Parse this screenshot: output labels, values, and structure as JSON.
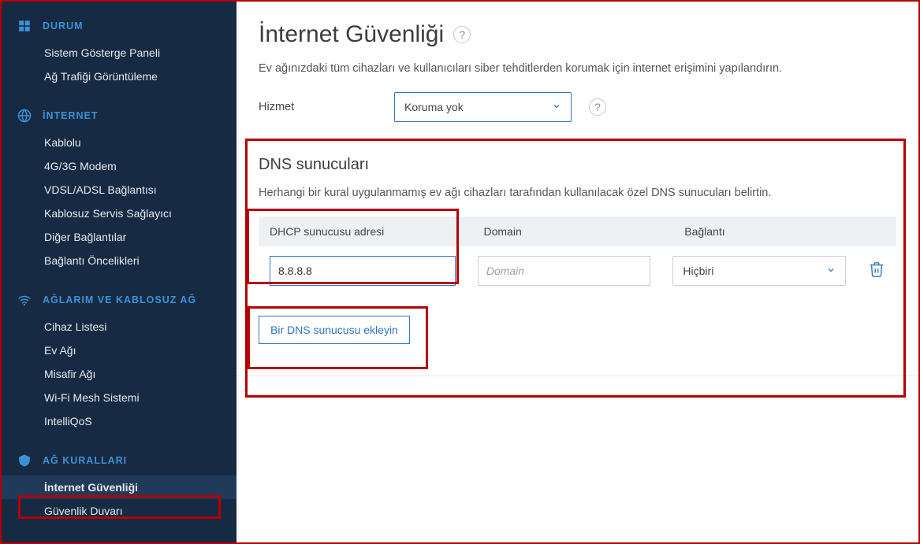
{
  "sidebar": {
    "sections": [
      {
        "title": "DURUM",
        "icon": "dashboard-icon",
        "items": [
          "Sistem Gösterge Paneli",
          "Ağ Trafiği Görüntüleme"
        ]
      },
      {
        "title": "İNTERNET",
        "icon": "globe-icon",
        "items": [
          "Kablolu",
          "4G/3G Modem",
          "VDSL/ADSL Bağlantısı",
          "Kablosuz Servis Sağlayıcı",
          "Diğer Bağlantılar",
          "Bağlantı Öncelikleri"
        ]
      },
      {
        "title": "AĞLARIM VE KABLOSUZ AĞ",
        "icon": "wifi-icon",
        "items": [
          "Cihaz Listesi",
          "Ev Ağı",
          "Misafir Ağı",
          "Wi-Fi Mesh Sistemi",
          "IntelliQoS"
        ]
      },
      {
        "title": "AĞ KURALLARI",
        "icon": "shield-icon",
        "items": [
          "İnternet Güvenliği",
          "Güvenlik Duvarı"
        ],
        "activeIndex": 0
      }
    ]
  },
  "main": {
    "title": "İnternet Güvenliği",
    "subtitle": "Ev ağınızdaki tüm cihazları ve kullanıcıları siber tehditlerden korumak için internet erişimini yapılandırın.",
    "serviceLabel": "Hizmet",
    "serviceValue": "Koruma yok",
    "dns": {
      "title": "DNS sunucuları",
      "hint": "Herhangi bir kural uygulanmamış ev ağı cihazları tarafından kullanılacak özel DNS sunucuları belirtin.",
      "headers": {
        "dhcp": "DHCP sunucusu adresi",
        "domain": "Domain",
        "conn": "Bağlantı"
      },
      "row": {
        "dhcpValue": "8.8.8.8",
        "domainPlaceholder": "Domain",
        "connValue": "Hiçbiri"
      },
      "addBtn": "Bir DNS sunucusu ekleyin"
    }
  }
}
